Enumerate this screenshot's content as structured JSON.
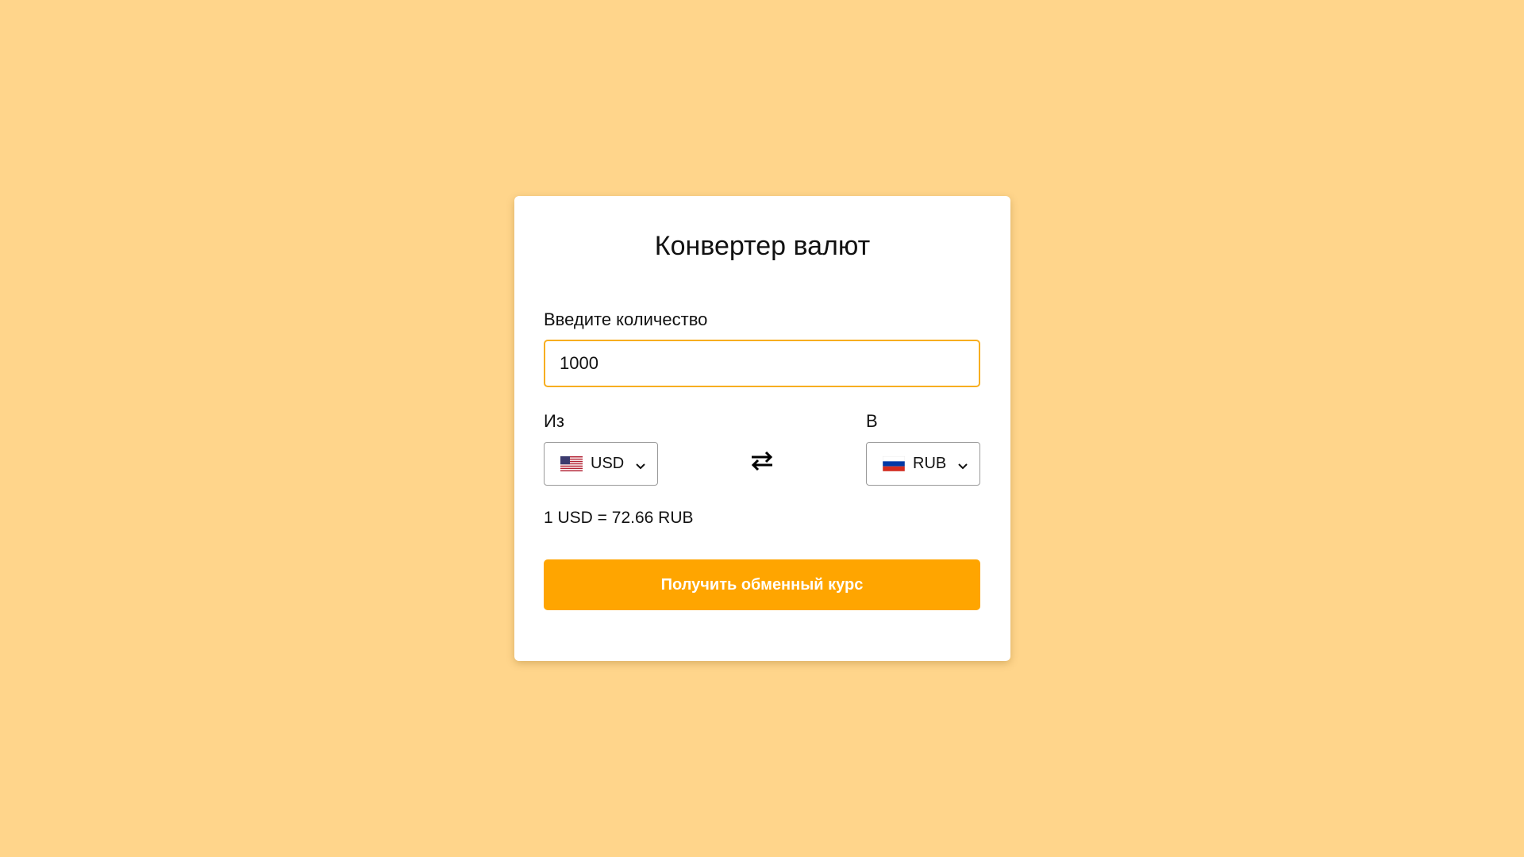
{
  "page": {
    "background_color": "#ffd58b"
  },
  "converter": {
    "title": "Конвертер валют",
    "amount_label": "Введите количество",
    "amount_value": "1000",
    "from_label": "Из",
    "to_label": "В",
    "from_currency": {
      "code": "USD",
      "flag_icon": "us-flag-icon"
    },
    "to_currency": {
      "code": "RUB",
      "flag_icon": "ru-flag-icon"
    },
    "swap_icon": "swap-arrows-icon",
    "rate_text": "1 USD = 72.66 RUB",
    "submit_label": "Получить обменный курс",
    "accent_color": "#ffa500"
  }
}
